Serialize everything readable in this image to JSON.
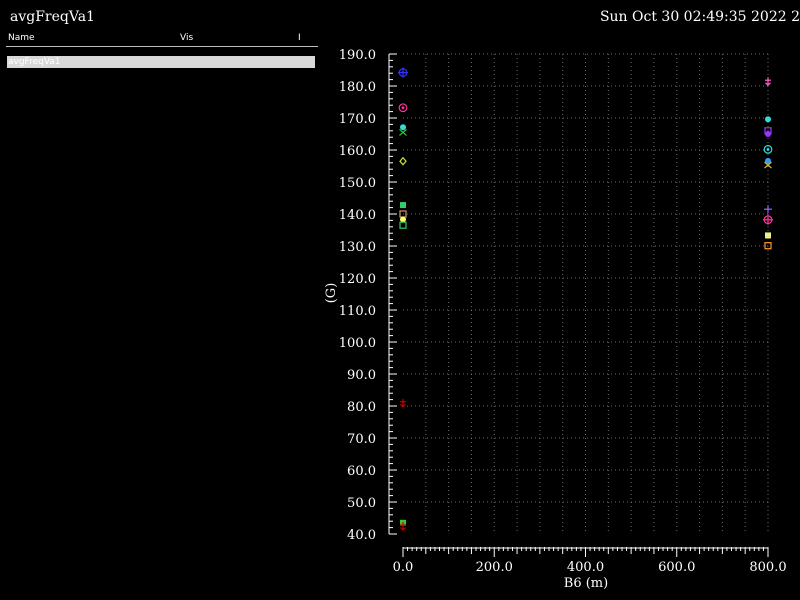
{
  "window": {
    "title": "avgFreqVa1",
    "timestamp": "Sun Oct 30 02:49:35 2022   2"
  },
  "signal_list": {
    "columns": [
      "Name",
      "Vis",
      "I"
    ],
    "rows": [
      {
        "name": "avgFreqVa1"
      }
    ]
  },
  "chart_data": {
    "type": "scatter",
    "xlabel": "B6 (m)",
    "ylabel": "(G)",
    "xlim": [
      0,
      800
    ],
    "ylim": [
      40,
      190
    ],
    "x_ticks": [
      "0.0",
      "200.0",
      "400.0",
      "600.0",
      "800.0"
    ],
    "y_ticks": [
      "40.0",
      "50.0",
      "60.0",
      "70.0",
      "80.0",
      "90.0",
      "100.0",
      "110.0",
      "120.0",
      "130.0",
      "140.0",
      "150.0",
      "160.0",
      "170.0",
      "180.0",
      "190.0"
    ],
    "grid": true,
    "points": [
      {
        "x": 0,
        "y": 184.2,
        "color": "#3333ff",
        "marker": "cross-circle"
      },
      {
        "x": 0,
        "y": 173.2,
        "color": "#ff3399",
        "marker": "circle-dot"
      },
      {
        "x": 0,
        "y": 167.1,
        "color": "#33dddd",
        "marker": "filled-circle"
      },
      {
        "x": 0,
        "y": 165.5,
        "color": "#33cc33",
        "marker": "x"
      },
      {
        "x": 0,
        "y": 156.5,
        "color": "#ccdd33",
        "marker": "diamond"
      },
      {
        "x": 0,
        "y": 142.8,
        "color": "#33cc66",
        "marker": "filled-square"
      },
      {
        "x": 0,
        "y": 140.0,
        "color": "#cc9966",
        "marker": "square"
      },
      {
        "x": 0,
        "y": 138.3,
        "color": "#ffff66",
        "marker": "filled-circle"
      },
      {
        "x": 0,
        "y": 136.5,
        "color": "#33cc66",
        "marker": "square"
      },
      {
        "x": 0,
        "y": 81.0,
        "color": "#cc0000",
        "marker": "arrow"
      },
      {
        "x": 0,
        "y": 43.5,
        "color": "#33cc33",
        "marker": "filled-square"
      },
      {
        "x": 0,
        "y": 42.5,
        "color": "#cc0000",
        "marker": "arrow"
      },
      {
        "x": 800,
        "y": 181.5,
        "color": "#ff66cc",
        "marker": "arrow"
      },
      {
        "x": 800,
        "y": 169.6,
        "color": "#33dddd",
        "marker": "filled-circle"
      },
      {
        "x": 800,
        "y": 166.0,
        "color": "#9933ff",
        "marker": "square"
      },
      {
        "x": 800,
        "y": 165.0,
        "color": "#9933ff",
        "marker": "filled-circle"
      },
      {
        "x": 800,
        "y": 160.2,
        "color": "#33dddd",
        "marker": "circle-dot"
      },
      {
        "x": 800,
        "y": 156.6,
        "color": "#3399ff",
        "marker": "filled-circle"
      },
      {
        "x": 800,
        "y": 155.3,
        "color": "#ddbb33",
        "marker": "x"
      },
      {
        "x": 800,
        "y": 141.5,
        "color": "#9966ff",
        "marker": "plus"
      },
      {
        "x": 800,
        "y": 138.2,
        "color": "#ff3399",
        "marker": "cross-circle"
      },
      {
        "x": 800,
        "y": 133.3,
        "color": "#eeee88",
        "marker": "filled-square"
      },
      {
        "x": 800,
        "y": 130.1,
        "color": "#ff9933",
        "marker": "square"
      }
    ]
  }
}
